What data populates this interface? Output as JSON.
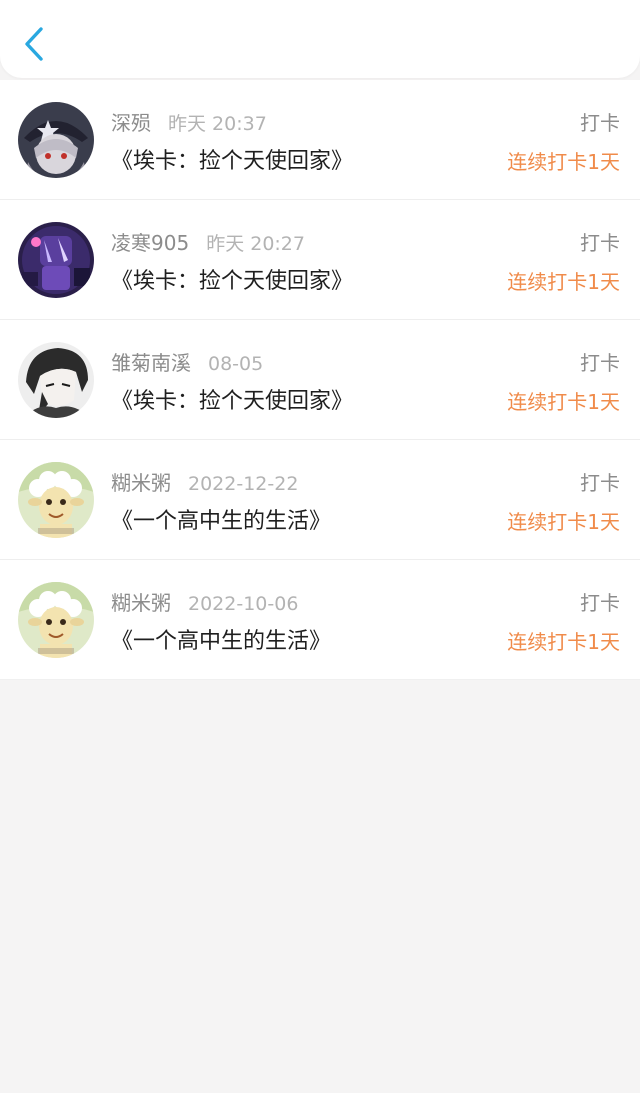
{
  "colors": {
    "accent_blue": "#29a8e0",
    "streak_orange": "#f08b4a",
    "muted_text": "#8c8c8c",
    "time_text": "#b3b3b3",
    "title_text": "#1f1f1f",
    "page_bg": "#f5f4f4"
  },
  "header": {
    "back_icon": "chevron-left-icon"
  },
  "records": [
    {
      "username": "深殒",
      "time": "昨天 20:37",
      "book_title": "《埃卡：捡个天使回家》",
      "action": "打卡",
      "streak": "连续打卡1天",
      "avatar": "anime-girl-hat-avatar"
    },
    {
      "username": "凌寒905",
      "time": "昨天 20:27",
      "book_title": "《埃卡：捡个天使回家》",
      "action": "打卡",
      "streak": "连续打卡1天",
      "avatar": "purple-character-avatar"
    },
    {
      "username": "雏菊南溪",
      "time": "08-05",
      "book_title": "《埃卡：捡个天使回家》",
      "action": "打卡",
      "streak": "连续打卡1天",
      "avatar": "dark-hair-boy-avatar"
    },
    {
      "username": "糊米粥",
      "time": "2022-12-22",
      "book_title": "《一个高中生的生活》",
      "action": "打卡",
      "streak": "连续打卡1天",
      "avatar": "sheep-cartoon-avatar"
    },
    {
      "username": "糊米粥",
      "time": "2022-10-06",
      "book_title": "《一个高中生的生活》",
      "action": "打卡",
      "streak": "连续打卡1天",
      "avatar": "sheep-cartoon-avatar"
    }
  ]
}
